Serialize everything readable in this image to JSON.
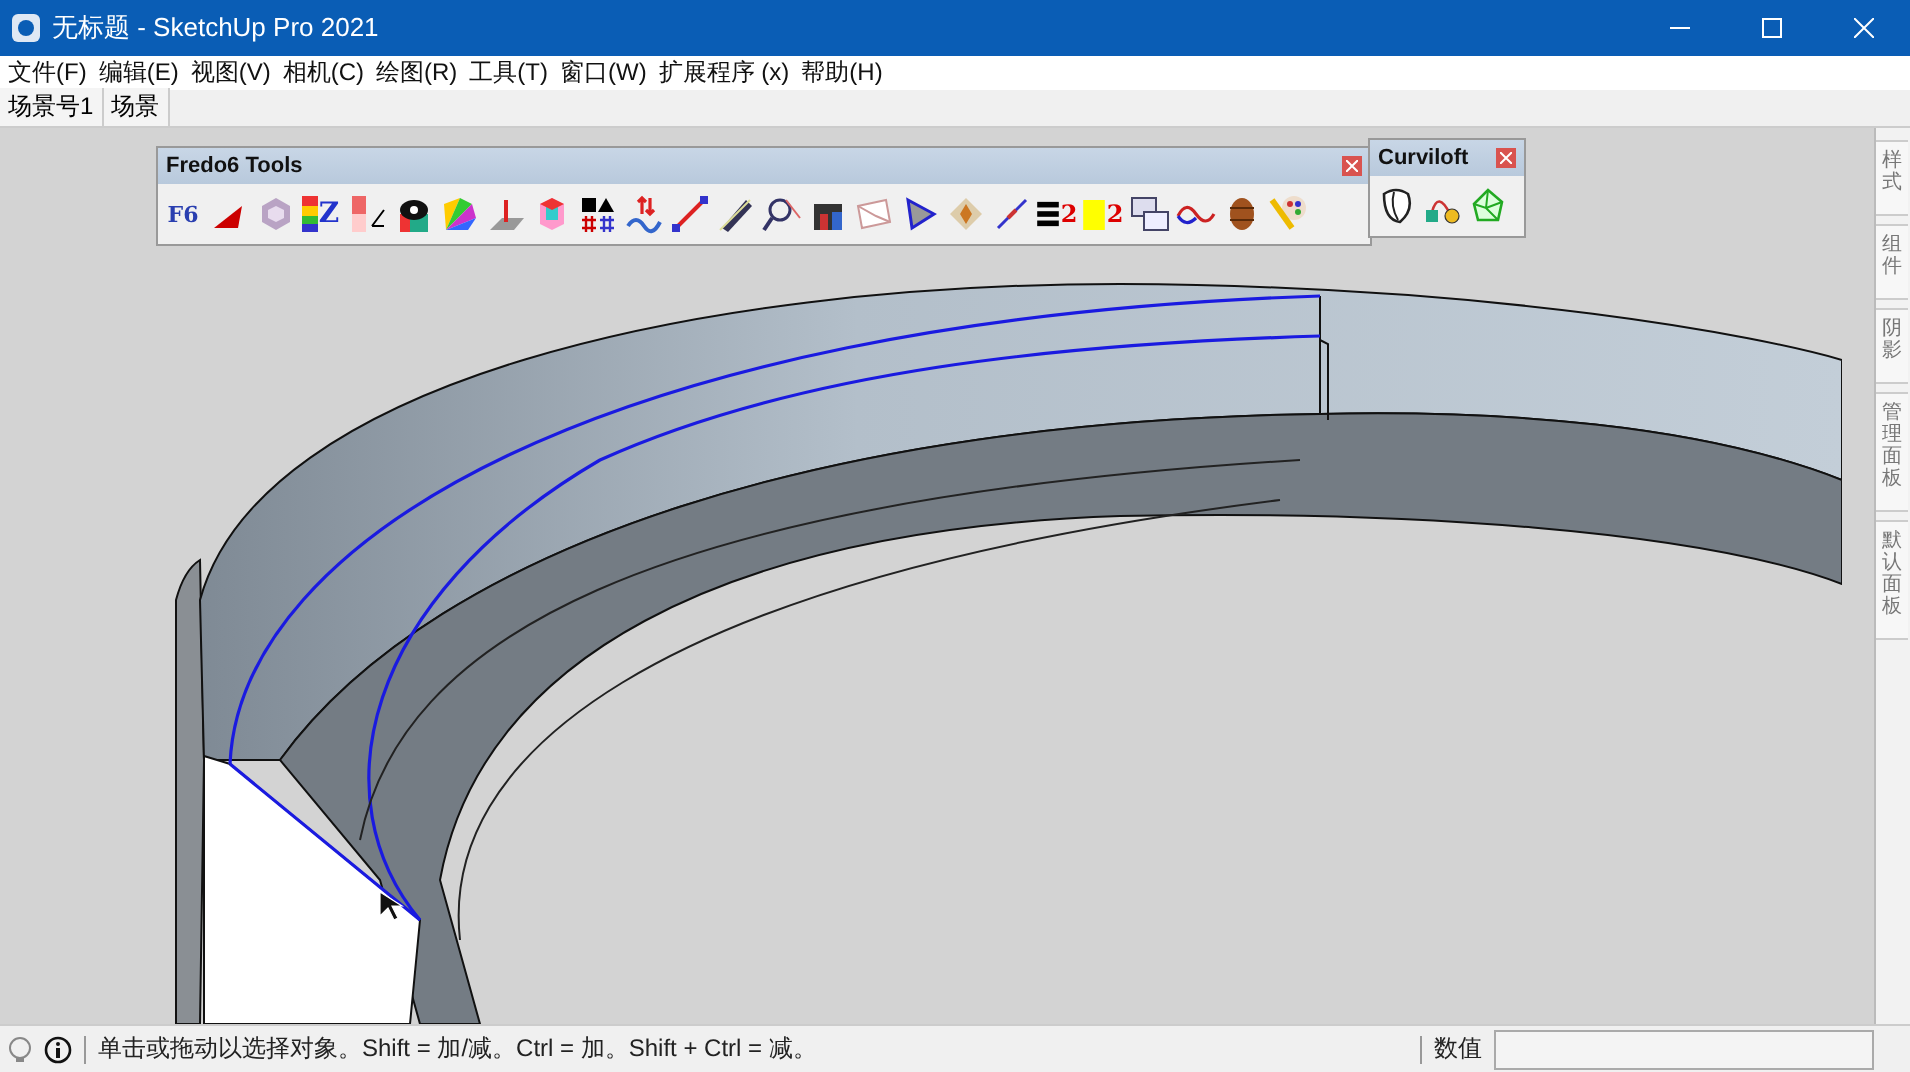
{
  "window": {
    "title": "无标题 - SketchUp Pro 2021"
  },
  "menu": [
    "文件(F)",
    "编辑(E)",
    "视图(V)",
    "相机(C)",
    "绘图(R)",
    "工具(T)",
    "窗口(W)",
    "扩展程序 (x)",
    "帮助(H)"
  ],
  "scene_tabs": [
    "场景号1",
    "场景"
  ],
  "fredo6_toolbar": {
    "title": "Fredo6 Tools",
    "glyphs": [
      "F6",
      "Z",
      "2",
      "2"
    ]
  },
  "curviloft_toolbar": {
    "title": "Curviloft"
  },
  "tray_tabs": [
    "样式",
    "组件",
    "阴影",
    "管理面板",
    "默认面板"
  ],
  "status_bar": {
    "message": "单击或拖动以选择对象。Shift = 加/减。Ctrl = 加。Shift + Ctrl = 减。",
    "measure_label": "数值"
  }
}
